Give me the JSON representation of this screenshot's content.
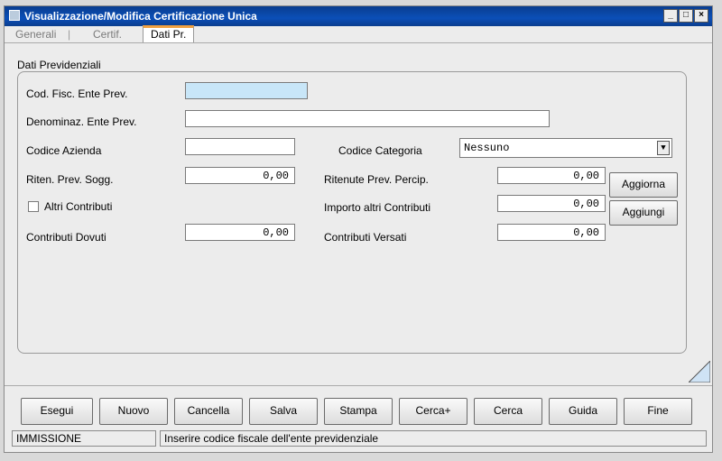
{
  "window": {
    "title": "Visualizzazione/Modifica Certificazione Unica"
  },
  "tabs": [
    {
      "label": "Generali",
      "active": false
    },
    {
      "label": "Certif.",
      "active": false
    },
    {
      "label": "Dati Pr.",
      "active": true
    }
  ],
  "group": {
    "title": "Dati Previdenziali"
  },
  "fields": {
    "cod_fisc_label": "Cod. Fisc. Ente Prev.",
    "cod_fisc_value": "",
    "denominaz_label": "Denominaz. Ente Prev.",
    "denominaz_value": "",
    "codice_azienda_label": "Codice Azienda",
    "codice_azienda_value": "",
    "codice_categoria_label": "Codice Categoria",
    "codice_categoria_value": "Nessuno",
    "riten_prev_sogg_label": "Riten. Prev. Sogg.",
    "riten_prev_sogg_value": "0,00",
    "ritenute_prev_percip_label": "Ritenute Prev. Percip.",
    "ritenute_prev_percip_value": "0,00",
    "altri_contributi_label": "Altri Contributi",
    "importo_altri_label": "Importo altri Contributi",
    "importo_altri_value": "0,00",
    "contributi_dovuti_label": "Contributi Dovuti",
    "contributi_dovuti_value": "0,00",
    "contributi_versati_label": "Contributi Versati",
    "contributi_versati_value": "0,00"
  },
  "side_buttons": {
    "aggiorna": "Aggiorna",
    "aggiungi": "Aggiungi"
  },
  "toolbar": {
    "esegui": "Esegui",
    "nuovo": "Nuovo",
    "cancella": "Cancella",
    "salva": "Salva",
    "stampa": "Stampa",
    "cerca_plus": "Cerca+",
    "cerca": "Cerca",
    "guida": "Guida",
    "fine": "Fine"
  },
  "status": {
    "mode": "IMMISSIONE",
    "message": "Inserire codice fiscale dell'ente previdenziale"
  },
  "colors": {
    "titlebar": "#0b4fb8",
    "highlight_field": "#c8e6f8",
    "active_tab_accent": "#f0a040"
  }
}
